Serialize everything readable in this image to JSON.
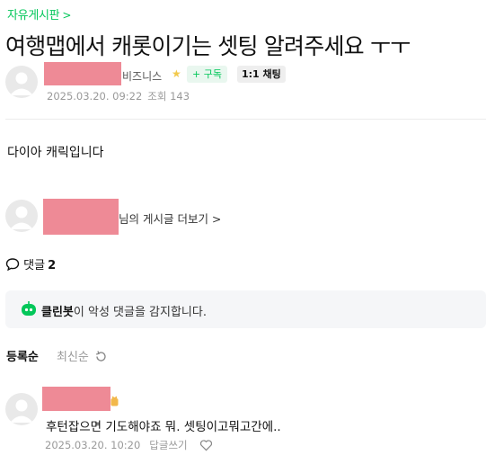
{
  "board": {
    "name": "자유게시판",
    "chevron": ">"
  },
  "post": {
    "title": "여행맵에서 캐롯이기는 셋팅 알려주세요 ㅜㅜ",
    "author_rank": "비즈니스",
    "subscribe_label": "+ 구독",
    "chat_label": "1:1 채팅",
    "date": "2025.03.20. 09:22",
    "views": "조회 143",
    "body": "다이아 캐릭입니다",
    "more_link": "님의 게시글 더보기 >"
  },
  "comments": {
    "label": "댓글",
    "count": "2",
    "bot_name": "클린봇",
    "bot_text": "이 악성 댓글을 감지합니다.",
    "sort_registered": "등록순",
    "sort_latest": "최신순",
    "items": [
      {
        "text": "후턴잡으면 기도해야죠 뭐. 셋팅이고뭐고간에..",
        "date": "2025.03.20. 10:20",
        "reply": "답글쓰기"
      }
    ]
  },
  "colors": {
    "accent": "#03c75a",
    "redaction": "#ee8a96"
  },
  "icons": [
    "chevron-right-icon",
    "avatar-icon",
    "star-icon",
    "comment-bubble-icon",
    "cleanbot-icon",
    "refresh-icon",
    "heart-icon",
    "crown-icon"
  ]
}
